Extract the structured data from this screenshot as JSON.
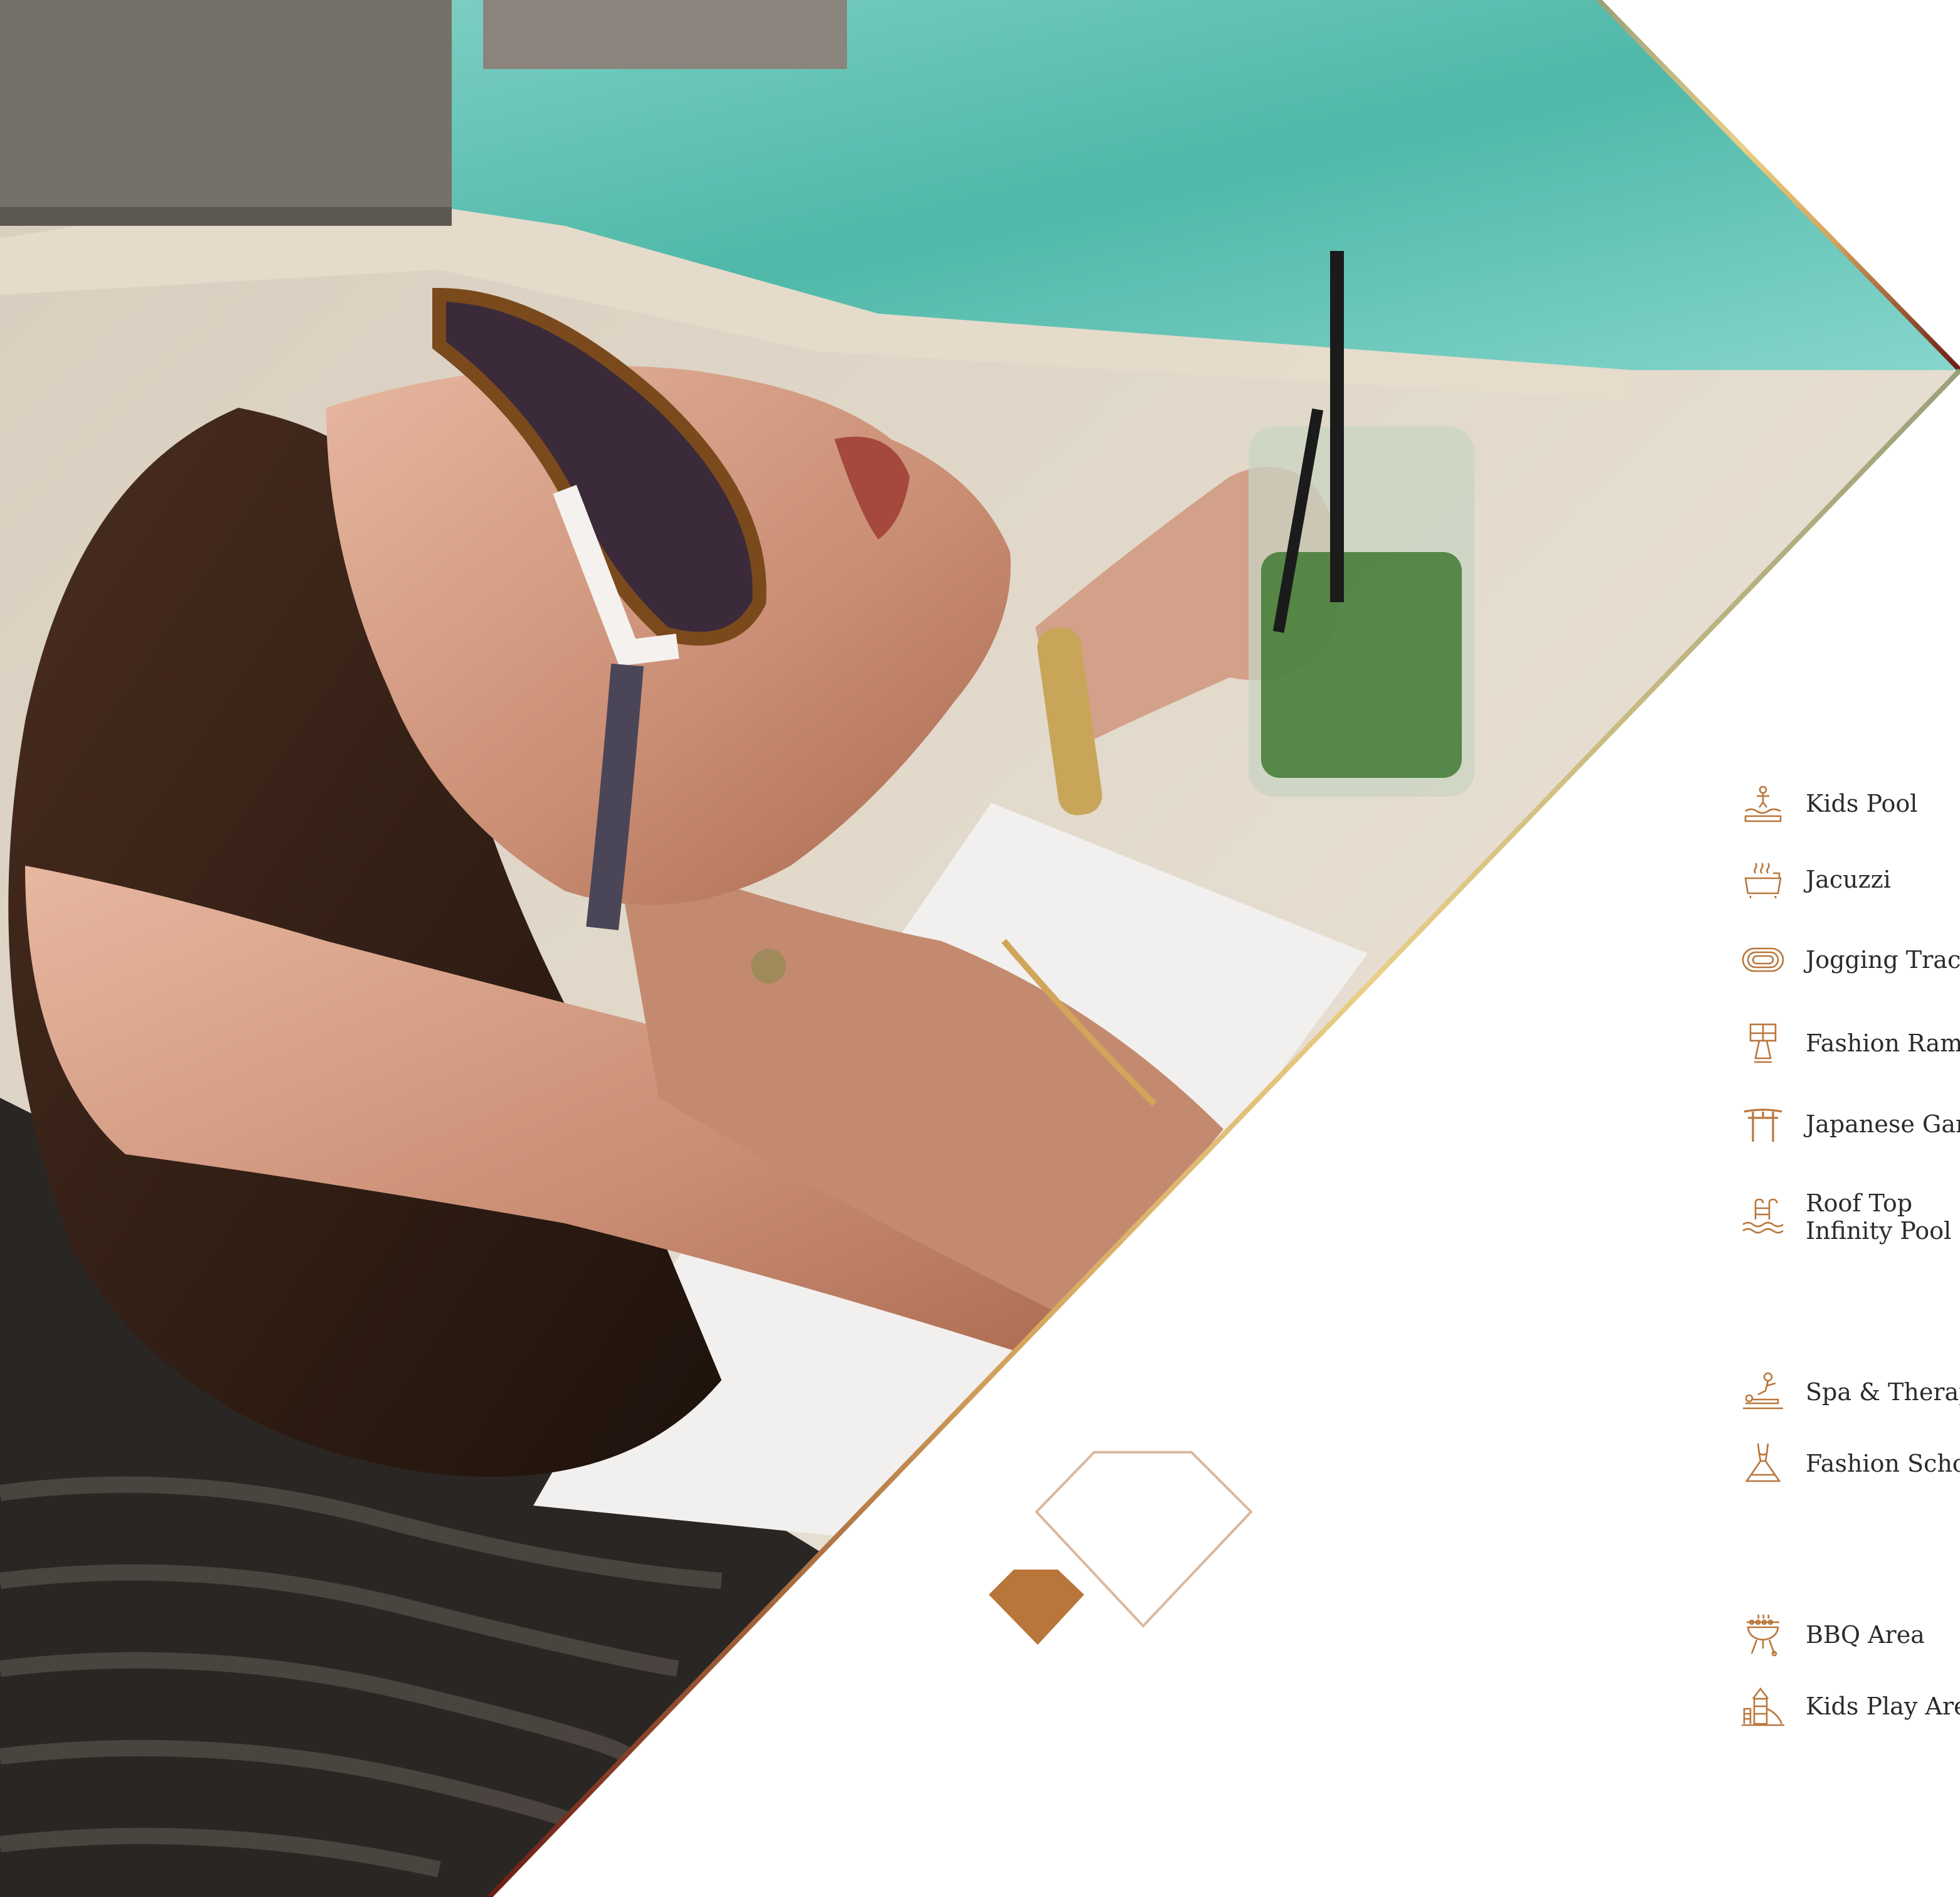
{
  "colors": {
    "accent": "#b9763a",
    "gold_light": "#e6c98a",
    "label": "#2b2b2b",
    "pool": "#5fc2b3",
    "deck": "#e9e0d1"
  },
  "amenities": {
    "kids_pool": {
      "label": "Kids Pool",
      "icon": "kids-pool-icon"
    },
    "jacuzzi": {
      "label": "Jacuzzi",
      "icon": "jacuzzi-icon"
    },
    "jogging_track": {
      "label": "Jogging Track",
      "icon": "jogging-track-icon"
    },
    "fashion_ramp": {
      "label": "Fashion Ramp",
      "icon": "fashion-ramp-icon"
    },
    "japanese_garden": {
      "label": "Japanese Garden",
      "icon": "torii-gate-icon"
    },
    "roof_top_infinity_pool": {
      "line1": "Roof Top",
      "line2": "Infinity Pool",
      "icon": "pool-ladder-icon"
    },
    "spa_therapy": {
      "label": "Spa & Therapy",
      "icon": "spa-massage-icon"
    },
    "fashion_school": {
      "label": "Fashion School",
      "icon": "dress-form-icon"
    },
    "bbq_area": {
      "label": "BBQ Area",
      "icon": "bbq-grill-icon"
    },
    "kids_play_area": {
      "label": "Kids Play Area",
      "icon": "playground-icon"
    }
  }
}
